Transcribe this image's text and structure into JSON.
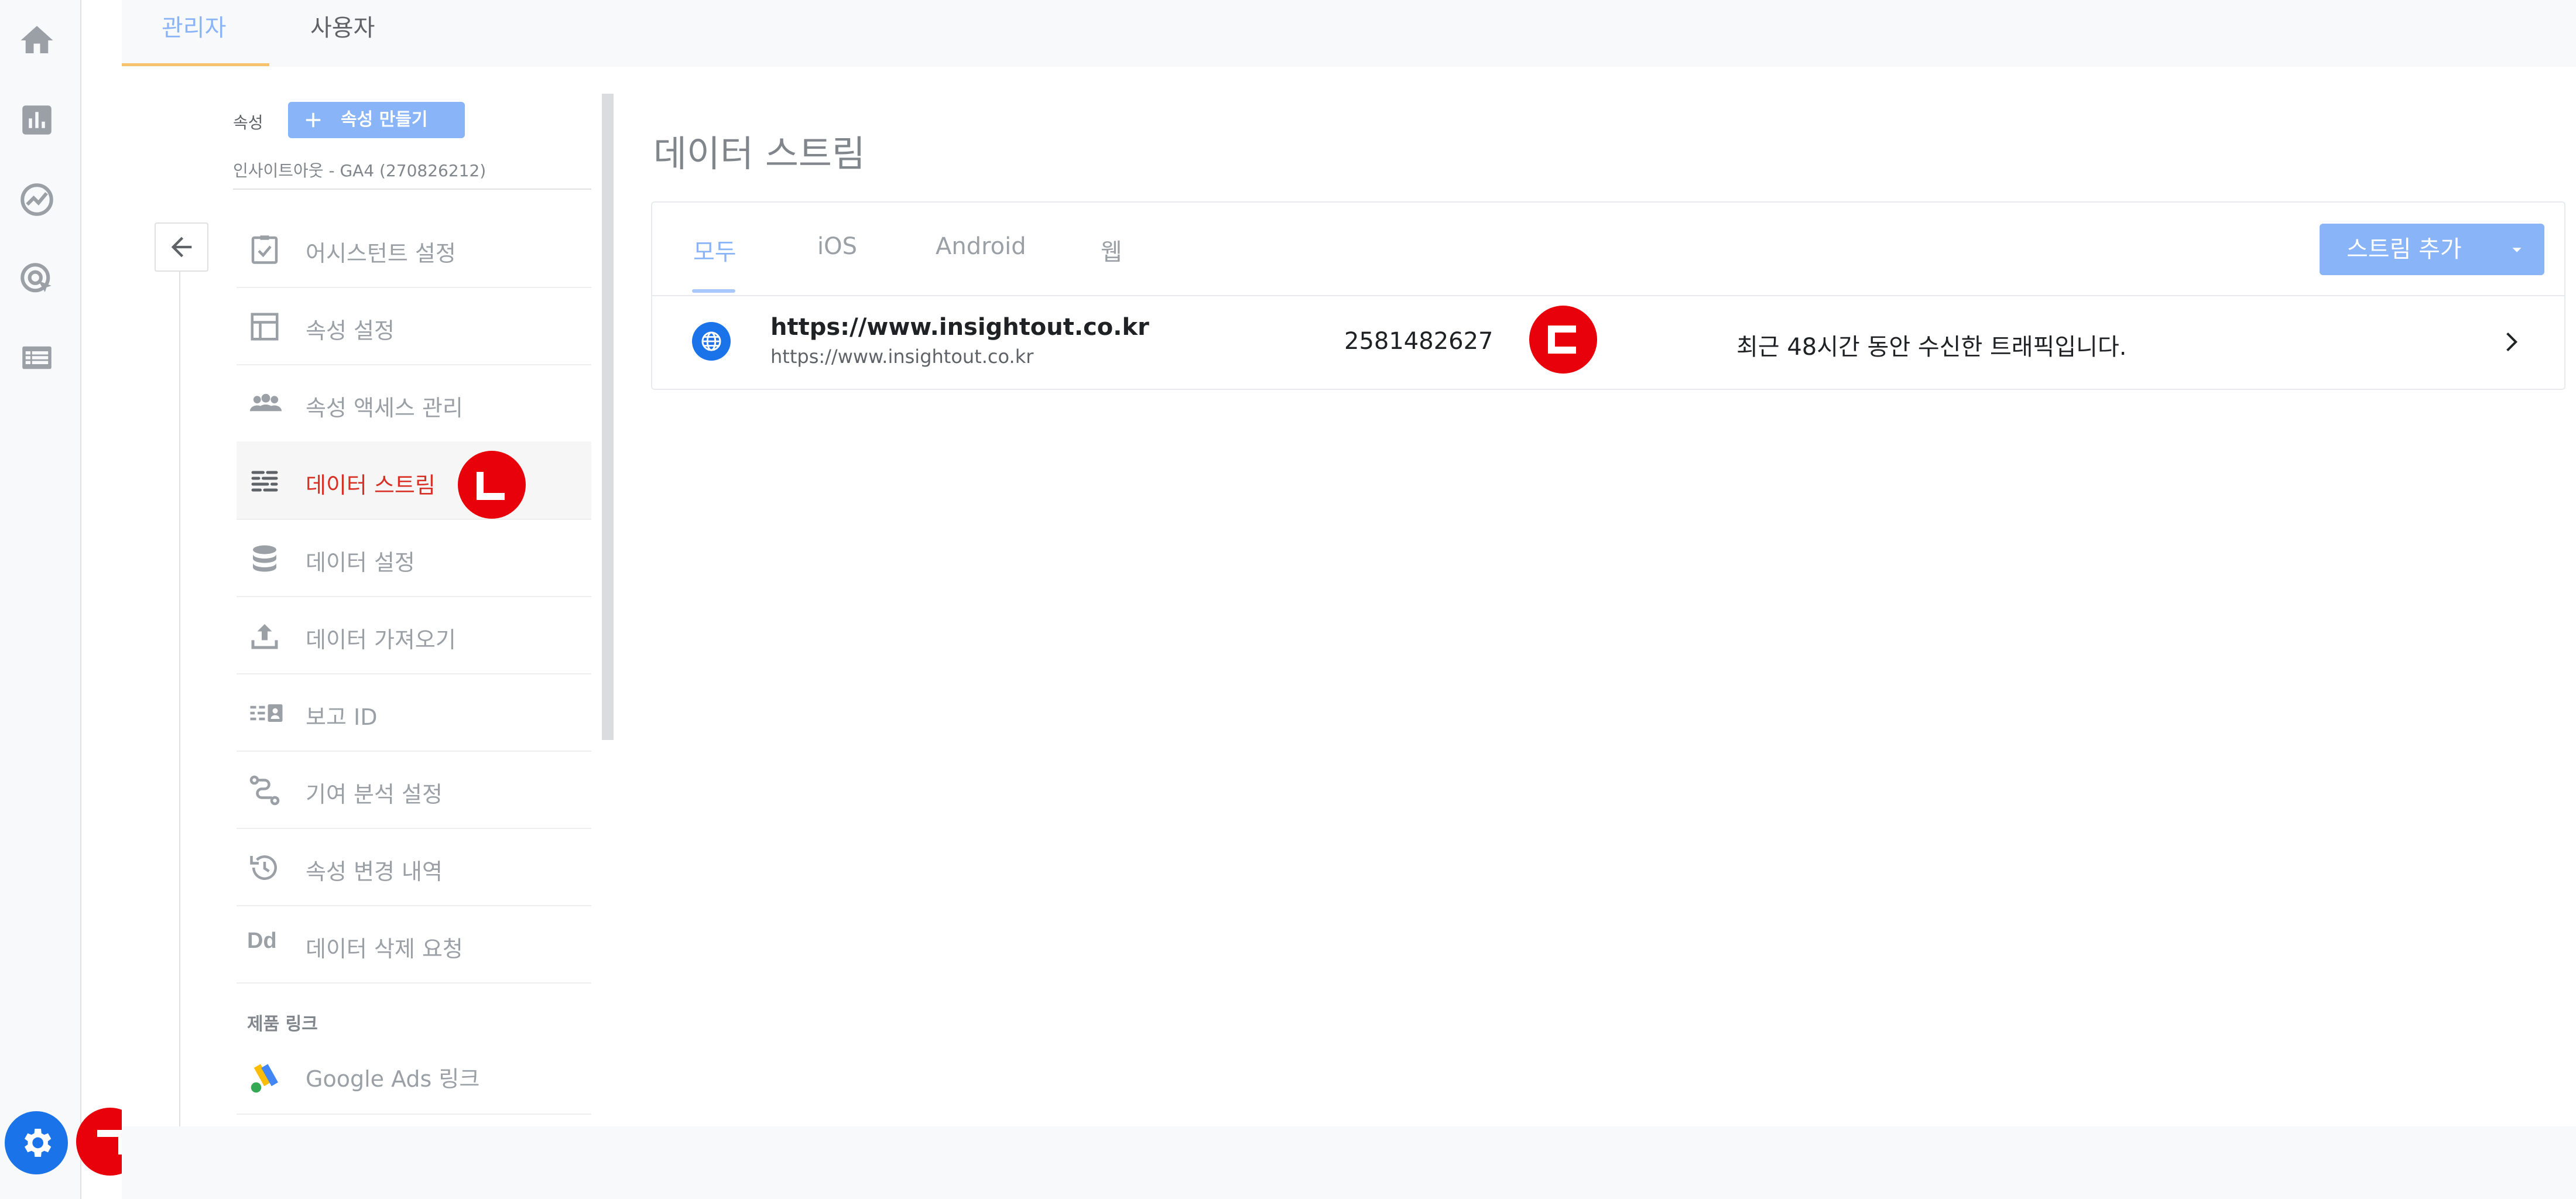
{
  "top_tabs": [
    {
      "label": "관리자",
      "active": true
    },
    {
      "label": "사용자",
      "active": false
    }
  ],
  "rail": {
    "icons": [
      "home-icon",
      "bar-chart-icon",
      "explore-icon",
      "advertising-icon",
      "list-icon"
    ],
    "settings_icon": "gear-icon"
  },
  "property": {
    "label": "속성",
    "create_button": "속성 만들기",
    "name": "인사이트아웃 - GA4 (270826212)"
  },
  "menu": [
    {
      "label": "어시스턴트 설정",
      "icon": "assistant-checklist-icon"
    },
    {
      "label": "속성 설정",
      "icon": "layout-icon"
    },
    {
      "label": "속성 액세스 관리",
      "icon": "people-icon"
    },
    {
      "label": "데이터 스트림",
      "icon": "data-streams-icon",
      "active": true
    },
    {
      "label": "데이터 설정",
      "icon": "database-icon"
    },
    {
      "label": "데이터 가져오기",
      "icon": "upload-icon"
    },
    {
      "label": "보고 ID",
      "icon": "reporting-identity-icon"
    },
    {
      "label": "기여 분석 설정",
      "icon": "attribution-icon"
    },
    {
      "label": "속성 변경 내역",
      "icon": "history-icon"
    },
    {
      "label": "데이터 삭제 요청",
      "icon": "dd-icon",
      "icon_text": "Dd"
    }
  ],
  "product_links": {
    "section_label": "제품 링크",
    "items": [
      {
        "label": "Google Ads 링크",
        "icon": "google-ads-icon"
      }
    ]
  },
  "main": {
    "title": "데이터 스트림",
    "tabs": [
      {
        "label": "모두",
        "active": true
      },
      {
        "label": "iOS"
      },
      {
        "label": "Android"
      },
      {
        "label": "웹"
      }
    ],
    "add_stream_button": "스트림 추가",
    "streams": [
      {
        "name": "https://www.insightout.co.kr",
        "url": "https://www.insightout.co.kr",
        "id": "2581482627",
        "status": "최근 48시간 동안 수신한 트래픽입니다."
      }
    ]
  },
  "markers": [
    "ㄱ",
    "ㄴ",
    "ㄷ"
  ],
  "colors": {
    "accent_blue": "#1a73e8",
    "light_blue": "#8ab4f8",
    "active_red": "#d93025",
    "marker_red": "#e8000b",
    "tab_underline_orange": "#f6c26b"
  }
}
